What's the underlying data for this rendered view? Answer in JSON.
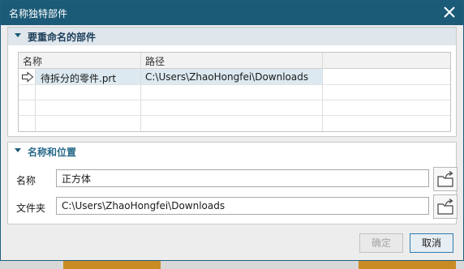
{
  "dialog": {
    "title": "名称独特部件",
    "close_icon": "close-icon"
  },
  "parts_section": {
    "title": "要重命名的部件",
    "columns": [
      "名称",
      "路径"
    ],
    "rows": [
      {
        "name": "待拆分的零件.prt",
        "path": "C:\\Users\\ZhaoHongfei\\Downloads"
      }
    ],
    "row_marker_icon": "arrow-right-icon"
  },
  "location_section": {
    "title": "名称和位置",
    "name_label": "名称",
    "name_value": "正方体",
    "folder_label": "文件夹",
    "folder_value": "C:\\Users\\ZhaoHongfei\\Downloads",
    "browse_icon": "folder-browse-icon"
  },
  "footer": {
    "ok_label": "确定",
    "cancel_label": "取消"
  }
}
